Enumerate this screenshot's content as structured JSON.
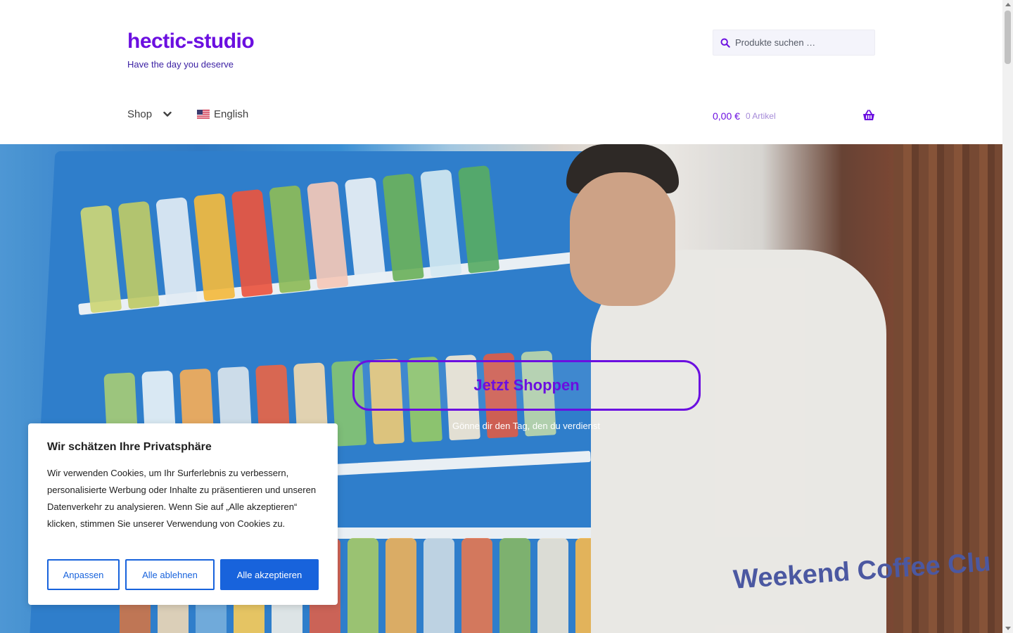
{
  "site": {
    "title": "hectic-studio",
    "tagline": "Have the day you deserve"
  },
  "search": {
    "placeholder": "Produkte suchen …",
    "icon": "search-icon"
  },
  "nav": {
    "shop_label": "Shop",
    "language_label": "English",
    "language_flag": "us-flag-icon"
  },
  "cart": {
    "amount": "0,00 €",
    "count": "0 Artikel",
    "icon": "basket-icon"
  },
  "hero": {
    "cta_label": "Jetzt Shoppen",
    "subtitle": "Gönne dir den Tag, den du verdienst",
    "shirt_print": "Weekend Coffee Clu"
  },
  "cookie_banner": {
    "title": "Wir schätzen Ihre Privatsphäre",
    "text": "Wir verwenden Cookies, um Ihr Surferlebnis zu verbessern, personalisierte Werbung oder Inhalte zu präsentieren und unseren Datenverkehr zu analysieren. Wenn Sie auf „Alle akzeptieren“ klicken, stimmen Sie unserer Verwendung von Cookies zu.",
    "customize_label": "Anpassen",
    "reject_label": "Alle ablehnen",
    "accept_label": "Alle akzeptieren"
  },
  "colors": {
    "brand": "#6b0fe0",
    "tagline": "#3a1fa3",
    "cookie_accent": "#1863dc"
  }
}
